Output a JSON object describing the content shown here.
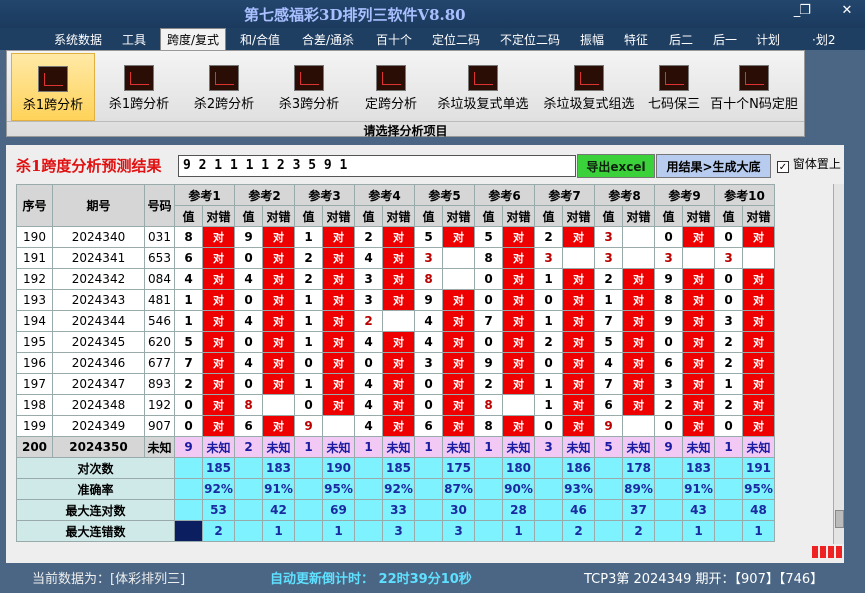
{
  "window": {
    "title": "第七感福彩3D排列三软件V8.80",
    "min": "_",
    "restore": "❐",
    "close": "✕"
  },
  "menu": [
    "系统数据",
    "工具",
    "跨度/复式",
    "和/合值",
    "合差/通杀",
    "百十个",
    "定位二码",
    "不定位二码",
    "振幅",
    "特征",
    "后二",
    "后一",
    "计划",
    "·划2"
  ],
  "ribbon": {
    "items": [
      "杀1跨分析",
      "杀1跨分析",
      "杀2跨分析",
      "杀3跨分析",
      "定跨分析",
      "杀垃圾复式单选",
      "杀垃圾复式组选",
      "七码保三",
      "百十个N码定胆"
    ],
    "group_label": "请选择分析项目"
  },
  "result": {
    "title": "杀1跨度分析预测结果",
    "value": "9 2 1 1 1 1 2 3 5 9 1",
    "excel_btn": "导出excel",
    "gen_btn": "用结果>生成大底",
    "ontop_label": "窗体置上",
    "ontop_check": "✓"
  },
  "table": {
    "headers": {
      "seq": "序号",
      "period": "期号",
      "num": "号码"
    },
    "refs": [
      "参考1",
      "参考2",
      "参考3",
      "参考4",
      "参考5",
      "参考6",
      "参考7",
      "参考8",
      "参考9",
      "参考10"
    ],
    "sub": [
      "值",
      "对错"
    ],
    "right_mark": "对",
    "unknown": "未知",
    "rows": [
      {
        "seq": "190",
        "period": "2024340",
        "num": "031",
        "vals": [
          "8",
          "9",
          "1",
          "2",
          "5",
          "5",
          "2",
          "3",
          "0",
          "0"
        ]
      },
      {
        "seq": "191",
        "period": "2024341",
        "num": "653",
        "vals": [
          "6",
          "0",
          "2",
          "4",
          "3",
          "8",
          "3",
          "3",
          "3",
          "3"
        ]
      },
      {
        "seq": "192",
        "period": "2024342",
        "num": "084",
        "vals": [
          "4",
          "4",
          "2",
          "3",
          "8",
          "0",
          "1",
          "2",
          "9",
          "0"
        ]
      },
      {
        "seq": "193",
        "period": "2024343",
        "num": "481",
        "vals": [
          "1",
          "0",
          "1",
          "3",
          "9",
          "0",
          "0",
          "1",
          "8",
          "0"
        ]
      },
      {
        "seq": "194",
        "period": "2024344",
        "num": "546",
        "vals": [
          "1",
          "4",
          "1",
          "2",
          "4",
          "7",
          "1",
          "7",
          "9",
          "3"
        ]
      },
      {
        "seq": "195",
        "period": "2024345",
        "num": "620",
        "vals": [
          "5",
          "0",
          "1",
          "4",
          "4",
          "0",
          "2",
          "5",
          "0",
          "2"
        ]
      },
      {
        "seq": "196",
        "period": "2024346",
        "num": "677",
        "vals": [
          "7",
          "4",
          "0",
          "0",
          "3",
          "9",
          "0",
          "4",
          "6",
          "2"
        ]
      },
      {
        "seq": "197",
        "period": "2024347",
        "num": "893",
        "vals": [
          "2",
          "0",
          "1",
          "4",
          "0",
          "2",
          "1",
          "7",
          "3",
          "1"
        ]
      },
      {
        "seq": "198",
        "period": "2024348",
        "num": "192",
        "vals": [
          "0",
          "8",
          "0",
          "4",
          "0",
          "8",
          "1",
          "6",
          "2",
          "2"
        ]
      },
      {
        "seq": "199",
        "period": "2024349",
        "num": "907",
        "vals": [
          "0",
          "6",
          "9",
          "4",
          "6",
          "8",
          "0",
          "9",
          "0",
          "0"
        ]
      }
    ],
    "last": {
      "seq": "200",
      "period": "2024350",
      "num": "未知",
      "vals": [
        "9",
        "2",
        "1",
        "1",
        "1",
        "1",
        "3",
        "5",
        "9",
        "1"
      ]
    },
    "stats": [
      {
        "label": "对次数",
        "vals": [
          "185",
          "183",
          "190",
          "185",
          "175",
          "180",
          "186",
          "178",
          "183",
          "191"
        ]
      },
      {
        "label": "准确率",
        "vals": [
          "92%",
          "91%",
          "95%",
          "92%",
          "87%",
          "90%",
          "93%",
          "89%",
          "91%",
          "95%"
        ]
      },
      {
        "label": "最大连对数",
        "vals": [
          "53",
          "42",
          "69",
          "33",
          "30",
          "28",
          "46",
          "37",
          "43",
          "48"
        ]
      },
      {
        "label": "最大连错数",
        "vals": [
          "2",
          "1",
          "1",
          "3",
          "3",
          "1",
          "2",
          "2",
          "1",
          "1"
        ]
      }
    ]
  },
  "status": {
    "data_source": "当前数据为：[体彩排列三]",
    "countdown": "自动更新倒计时：  22时39分10秒",
    "draw": "TCP3第 2024349 期开：【907】【746】"
  }
}
